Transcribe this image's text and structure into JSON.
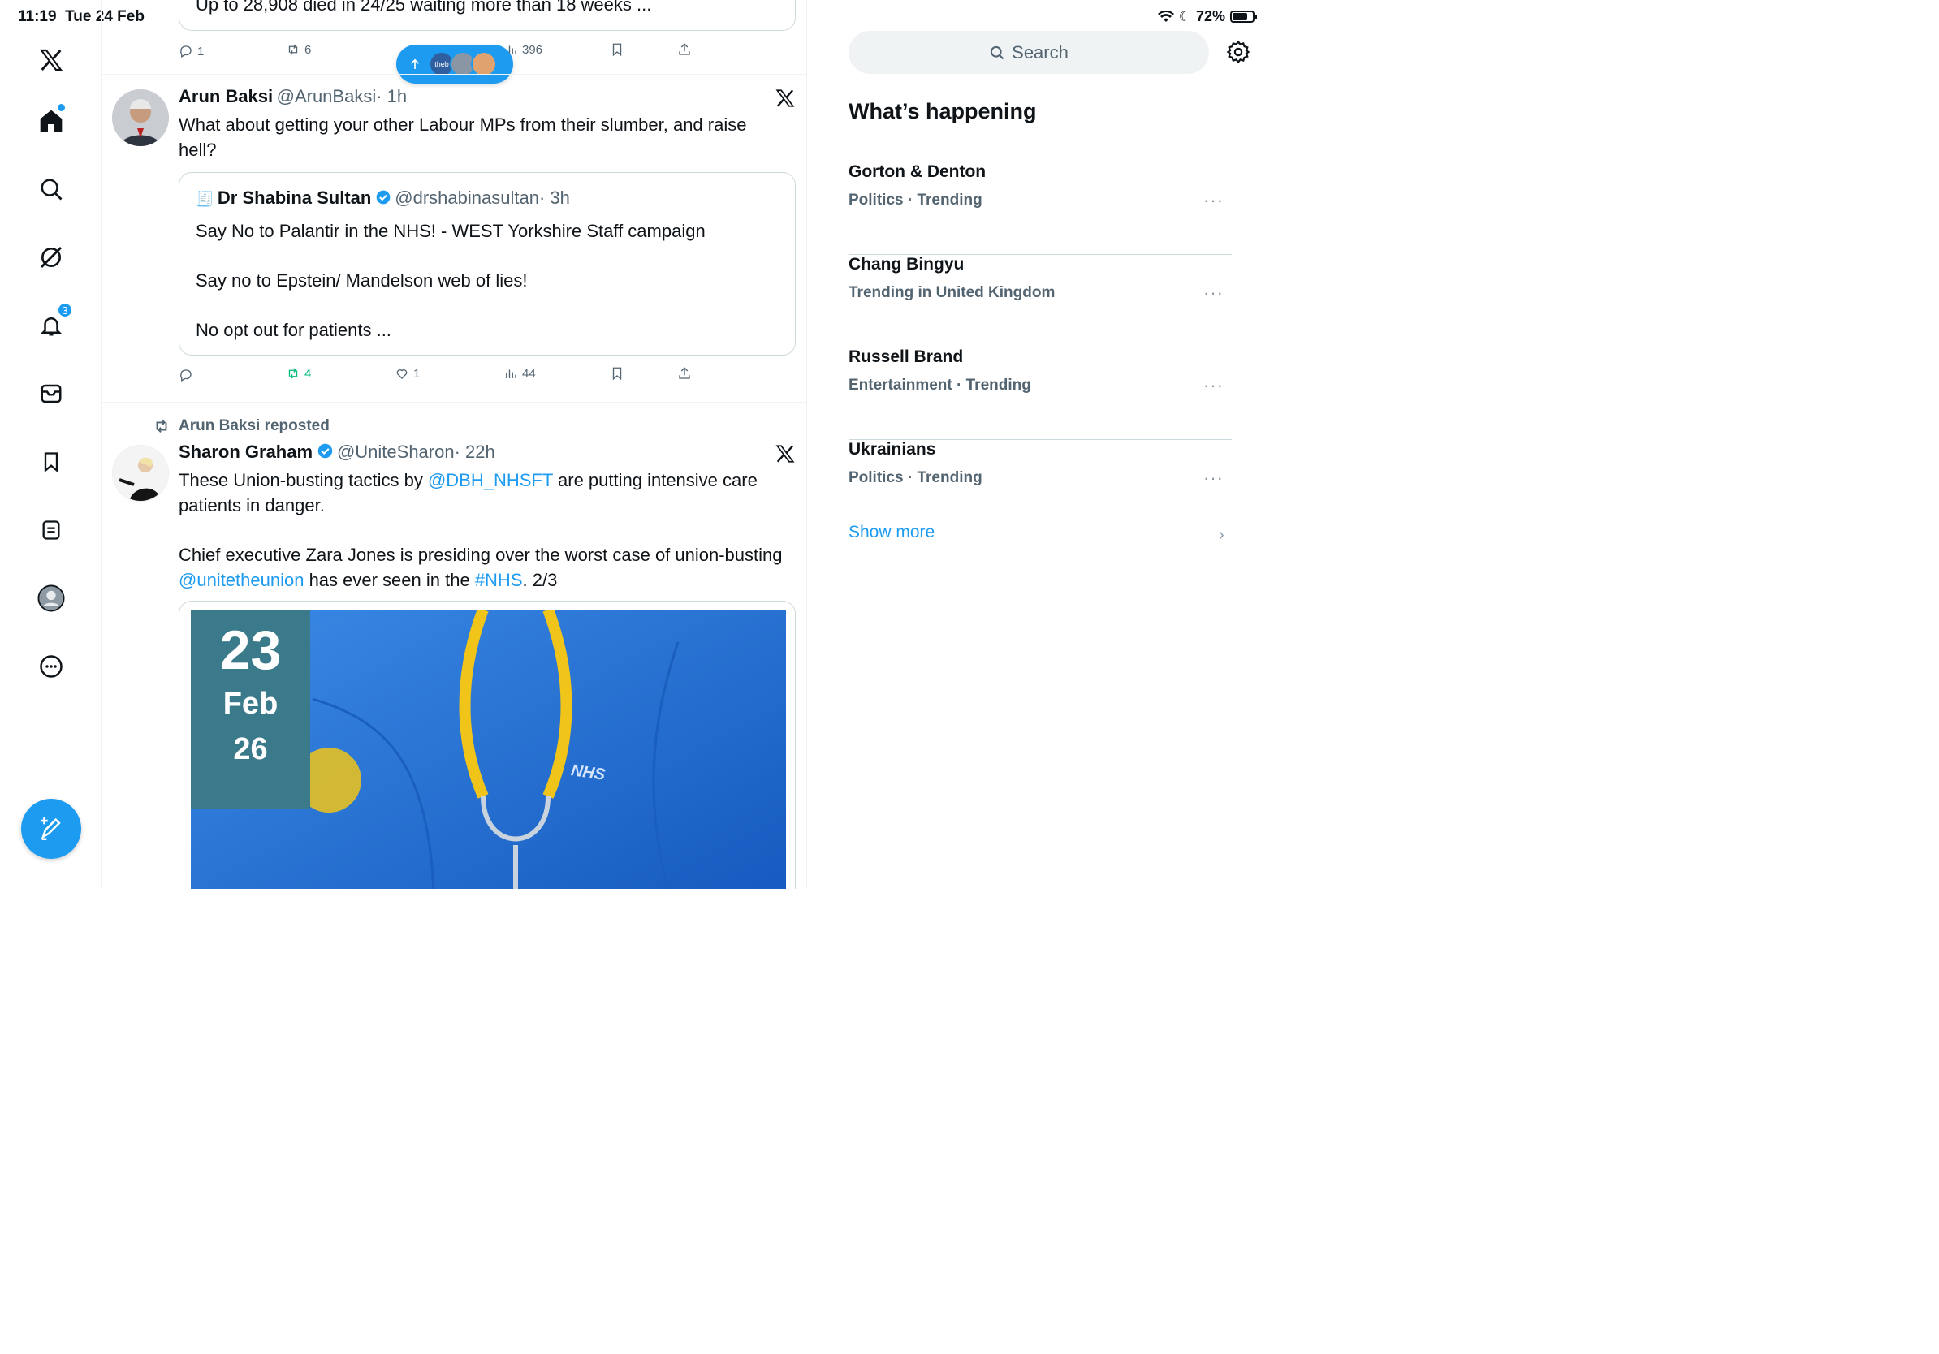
{
  "status_bar": {
    "time": "11:19",
    "date": "Tue 24 Feb",
    "battery": "72%"
  },
  "sidebar": {
    "items": [
      {
        "name": "x-logo"
      },
      {
        "name": "home"
      },
      {
        "name": "search"
      },
      {
        "name": "grok"
      },
      {
        "name": "notifications",
        "badge": "3"
      },
      {
        "name": "messages"
      },
      {
        "name": "bookmarks"
      },
      {
        "name": "lists"
      },
      {
        "name": "profile"
      },
      {
        "name": "more"
      }
    ],
    "compose_label": "Compose"
  },
  "timeline": {
    "top_tweet": {
      "text": "Up to 28,908 died in 24/25 waiting more than 18 weeks ...",
      "replies": "1",
      "reposts": "6",
      "views": "396"
    },
    "new_posts_pill": {
      "label": "theb"
    },
    "tweet1": {
      "name": "Arun Baksi",
      "handle": "@ArunBaksi",
      "time": "· 1h",
      "text": "What about getting your other Labour MPs from their slumber, and raise hell?",
      "quote": {
        "emoji": "🧾",
        "name": "Dr Shabina Sultan",
        "handle": "@drshabinasultan",
        "time": "· 3h",
        "line1": "Say No to Palantir in the NHS! - WEST Yorkshire Staff campaign",
        "line2": "Say no to Epstein/ Mandelson web of lies!",
        "line3": "No opt out for patients ..."
      },
      "replies": "",
      "reposts": "4",
      "likes": "1",
      "views": "44"
    },
    "tweet2": {
      "repost_label": "Arun Baksi reposted",
      "name": "Sharon Graham",
      "handle": "@UniteSharon",
      "time": "· 22h",
      "text_a": "These Union-busting tactics by ",
      "mention1": "@DBH_NHSFT",
      "text_b": " are  putting intensive care patients in danger.",
      "text_c": "Chief executive Zara Jones is presiding over the worst case of union-busting ",
      "mention2": "@unitetheunion",
      "text_d": " has ever seen in the ",
      "hashtag": "#NHS",
      "text_e": ". 2/3",
      "media": {
        "day": "23",
        "month": "Feb",
        "year": "26",
        "badge": "NHS"
      }
    }
  },
  "right": {
    "search_placeholder": "Search",
    "section_title": "What’s happening",
    "trends": [
      {
        "name": "Gorton & Denton",
        "meta": "Politics · Trending"
      },
      {
        "name": "Chang Bingyu",
        "meta": "Trending in United Kingdom"
      },
      {
        "name": "Russell Brand",
        "meta": "Entertainment · Trending"
      },
      {
        "name": "Ukrainians",
        "meta": "Politics · Trending"
      }
    ],
    "show_more": "Show more",
    "more_glyph": "···"
  },
  "colors": {
    "accent": "#1d9bf0",
    "repost_active": "#00ba7c",
    "text_secondary": "#536471"
  }
}
